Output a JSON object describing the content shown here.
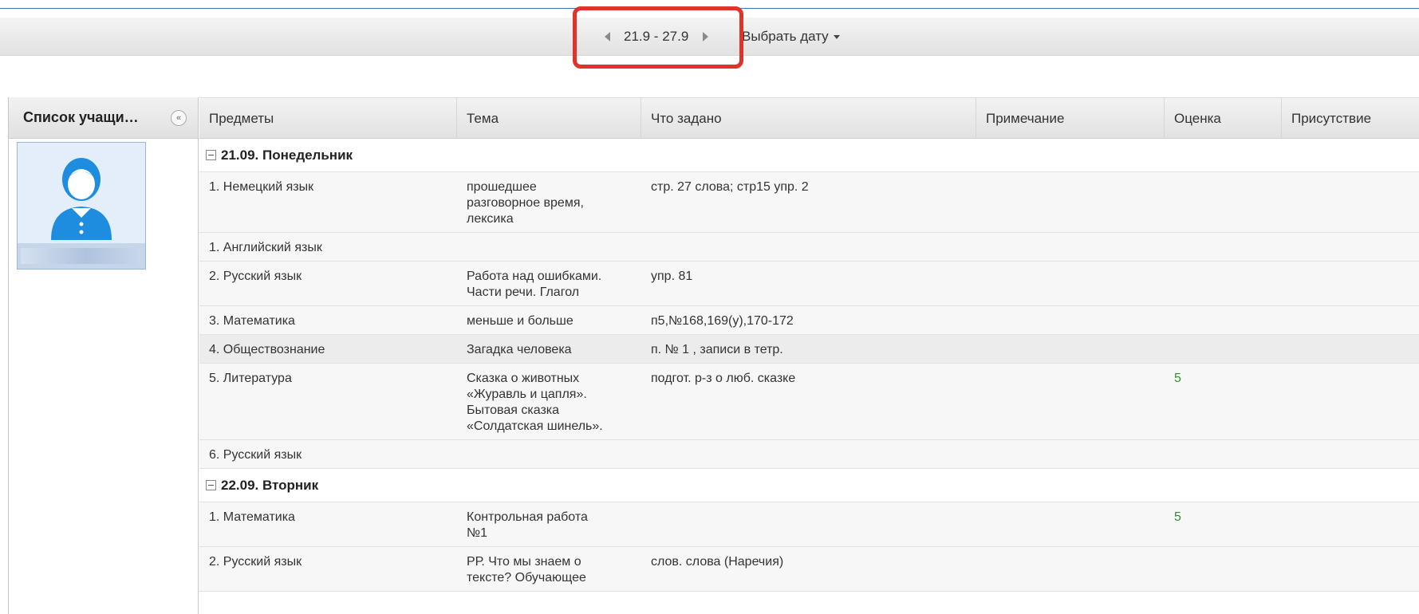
{
  "toolbar": {
    "date_range": "21.9 - 27.9",
    "pick_date_label": "Выбрать дату"
  },
  "sidebar": {
    "title": "Список учащи…",
    "collapse_glyph": "«"
  },
  "grid": {
    "headers": [
      "Предметы",
      "Тема",
      "Что задано",
      "Примечание",
      "Оценка",
      "Присутствие"
    ],
    "groups": [
      {
        "label": "21.09. Понедельник",
        "rows": [
          {
            "subject": "1. Немецкий язык",
            "topic": "прошедшее\nразговорное время,\nлексика",
            "homework": "стр. 27 слова; стр15 упр. 2",
            "note": "",
            "grade": "",
            "presence": ""
          },
          {
            "subject": "1. Английский язык",
            "topic": "",
            "homework": "",
            "note": "",
            "grade": "",
            "presence": ""
          },
          {
            "subject": "2. Русский язык",
            "topic": "Работа над ошибками.\nЧасти речи. Глагол",
            "homework": "упр. 81",
            "note": "",
            "grade": "",
            "presence": ""
          },
          {
            "subject": "3. Математика",
            "topic": "меньше и больше",
            "homework": "п5,№168,169(у),170-172",
            "note": "",
            "grade": "",
            "presence": ""
          },
          {
            "subject": "4. Обществознание",
            "topic": "Загадка человека",
            "homework": "п. № 1 , записи в тетр.",
            "note": "",
            "grade": "",
            "presence": ""
          },
          {
            "subject": "5. Литература",
            "topic": "Сказка о животных\n«Журавль и цапля».\nБытовая сказка\n«Солдатская шинель».",
            "homework": "подгот. р-з о люб. сказке",
            "note": "",
            "grade": "5",
            "presence": ""
          },
          {
            "subject": "6. Русский язык",
            "topic": "",
            "homework": "",
            "note": "",
            "grade": "",
            "presence": ""
          }
        ]
      },
      {
        "label": "22.09. Вторник",
        "rows": [
          {
            "subject": "1. Математика",
            "topic": "Контрольная работа\n№1",
            "homework": "",
            "note": "",
            "grade": "5",
            "presence": ""
          },
          {
            "subject": "2. Русский язык",
            "topic": "РР. Что мы знаем о\nтексте? Обучающее",
            "homework": "слов. слова (Наречия)",
            "note": "",
            "grade": "",
            "presence": ""
          }
        ]
      }
    ]
  },
  "colors": {
    "highlight": "#e0342a",
    "grade": "#2f8f2f",
    "top_line": "#3c78b4"
  }
}
